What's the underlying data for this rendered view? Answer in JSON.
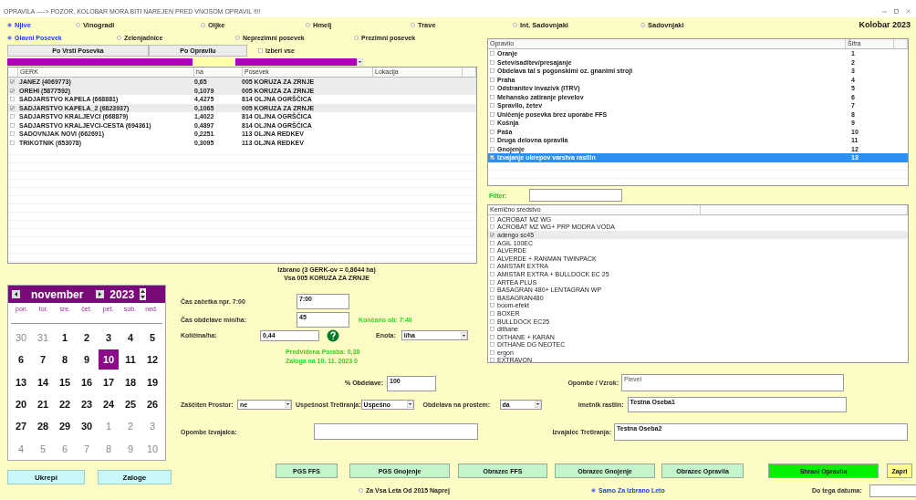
{
  "window": {
    "title": "OPRAVILA ----> POZOR, KOLOBAR MORA BITI NAREJEN PRED VNOSOM OPRAVIL !!!!"
  },
  "crop_types": [
    {
      "label": "Njive",
      "selected": true
    },
    {
      "label": "Vinogradi",
      "selected": false
    },
    {
      "label": "Oljke",
      "selected": false
    },
    {
      "label": "Hmelj",
      "selected": false
    },
    {
      "label": "Trave",
      "selected": false
    },
    {
      "label": "Int. Sadovnjaki",
      "selected": false
    },
    {
      "label": "Sadovnjaki",
      "selected": false
    }
  ],
  "year_label": "Kolobar 2023",
  "crop_groups": [
    {
      "label": "Glavni Posevek",
      "selected": true
    },
    {
      "label": "Zelenjadnice",
      "selected": false
    },
    {
      "label": "Neprezimni posevek",
      "selected": false
    },
    {
      "label": "Prezimni posevek",
      "selected": false
    }
  ],
  "sort_buttons": [
    "Po Vrsti Posevka",
    "Po Opravilu"
  ],
  "select_all": {
    "label": "Izberi vse",
    "checked": false
  },
  "fields_table": {
    "columns": [
      "GERK",
      "ha",
      "Posevek",
      "Lokacija"
    ],
    "rows": [
      {
        "checked": true,
        "cells": [
          "JANEZ (4069773)",
          "0,65",
          "005 KORUZA ZA ZRNJE"
        ]
      },
      {
        "checked": true,
        "cells": [
          "OREHI (5877592)",
          "0,1079",
          "005 KORUZA ZA ZRNJE"
        ]
      },
      {
        "checked": false,
        "cells": [
          "SADJARSTVO KAPELA (668881)",
          "4,4275",
          "814 OLJNA OGRŠČICA"
        ]
      },
      {
        "checked": true,
        "cells": [
          "SADJARSTVO KAPELA_2 (6823937)",
          "0,1065",
          "005 KORUZA ZA ZRNJE"
        ]
      },
      {
        "checked": false,
        "cells": [
          "SADJARSTVO KRALJEVCI (668879)",
          "1,4022",
          "814 OLJNA OGRŠČICA"
        ]
      },
      {
        "checked": false,
        "cells": [
          "SADJARSTVO KRALJEVCI-CESTA (694361)",
          "0,4897",
          "814 OLJNA OGRŠČICA"
        ]
      },
      {
        "checked": false,
        "cells": [
          "SADOVNJAK NOVI (662691)",
          "0,2251",
          "113 OLJNA REDKEV"
        ]
      },
      {
        "checked": false,
        "cells": [
          "TRIKOTNIK (653078)",
          "0,3095",
          "113 OLJNA REDKEV"
        ]
      }
    ]
  },
  "summary": [
    "Izbrano (3 GERK-ov = 0,8644 ha)",
    "Vsa 005 KORUZA ZA ZRNJE"
  ],
  "calendar": {
    "month": "november",
    "year": "2023",
    "weekdays": [
      "pon.",
      "tor.",
      "sre.",
      "čet.",
      "pet.",
      "sob.",
      "ned."
    ],
    "days": [
      {
        "label": "30",
        "in_month": false,
        "selected": false
      },
      {
        "label": "31",
        "in_month": false,
        "selected": false
      },
      {
        "label": "1",
        "in_month": true,
        "selected": false
      },
      {
        "label": "2",
        "in_month": true,
        "selected": false
      },
      {
        "label": "3",
        "in_month": true,
        "selected": false
      },
      {
        "label": "4",
        "in_month": true,
        "selected": false
      },
      {
        "label": "5",
        "in_month": true,
        "selected": false
      },
      {
        "label": "6",
        "in_month": true,
        "selected": false
      },
      {
        "label": "7",
        "in_month": true,
        "selected": false
      },
      {
        "label": "8",
        "in_month": true,
        "selected": false
      },
      {
        "label": "9",
        "in_month": true,
        "selected": false
      },
      {
        "label": "10",
        "in_month": true,
        "selected": true
      },
      {
        "label": "11",
        "in_month": true,
        "selected": false
      },
      {
        "label": "12",
        "in_month": true,
        "selected": false
      },
      {
        "label": "13",
        "in_month": true,
        "selected": false
      },
      {
        "label": "14",
        "in_month": true,
        "selected": false
      },
      {
        "label": "15",
        "in_month": true,
        "selected": false
      },
      {
        "label": "16",
        "in_month": true,
        "selected": false
      },
      {
        "label": "17",
        "in_month": true,
        "selected": false
      },
      {
        "label": "18",
        "in_month": true,
        "selected": false
      },
      {
        "label": "19",
        "in_month": true,
        "selected": false
      },
      {
        "label": "20",
        "in_month": true,
        "selected": false
      },
      {
        "label": "21",
        "in_month": true,
        "selected": false
      },
      {
        "label": "22",
        "in_month": true,
        "selected": false
      },
      {
        "label": "23",
        "in_month": true,
        "selected": false
      },
      {
        "label": "24",
        "in_month": true,
        "selected": false
      },
      {
        "label": "25",
        "in_month": true,
        "selected": false
      },
      {
        "label": "26",
        "in_month": true,
        "selected": false
      },
      {
        "label": "27",
        "in_month": true,
        "selected": false
      },
      {
        "label": "28",
        "in_month": true,
        "selected": false
      },
      {
        "label": "29",
        "in_month": true,
        "selected": false
      },
      {
        "label": "30",
        "in_month": true,
        "selected": false
      },
      {
        "label": "1",
        "in_month": false,
        "selected": false
      },
      {
        "label": "2",
        "in_month": false,
        "selected": false
      },
      {
        "label": "3",
        "in_month": false,
        "selected": false
      },
      {
        "label": "4",
        "in_month": false,
        "selected": false
      },
      {
        "label": "5",
        "in_month": false,
        "selected": false
      },
      {
        "label": "6",
        "in_month": false,
        "selected": false
      },
      {
        "label": "7",
        "in_month": false,
        "selected": false
      },
      {
        "label": "8",
        "in_month": false,
        "selected": false
      },
      {
        "label": "9",
        "in_month": false,
        "selected": false
      },
      {
        "label": "10",
        "in_month": false,
        "selected": false
      }
    ]
  },
  "side_buttons": [
    "Ukrepi",
    "Zaloge"
  ],
  "start_time": {
    "label": "Čas začetka npr. 7:00",
    "value": "7:00"
  },
  "duration": {
    "label": "Čas obdelave min/ha:",
    "value": "45"
  },
  "finish_note": "Končano ob: 7:40",
  "quantity": {
    "label": "Količina/ha:",
    "value": "0,44"
  },
  "unit": {
    "label": "Enota:",
    "value": "l/ha"
  },
  "forecast": [
    "Predvidena Poraba: 0,38",
    "Zaloga na 10. 11. 2023 0"
  ],
  "coverage": {
    "label": "% Obdelave:",
    "value": "100"
  },
  "protected_space": {
    "label": "Zaščiten Prostor:",
    "value": "ne"
  },
  "success": {
    "label": "Uspešnost Tretiranja:",
    "value": "Uspešno"
  },
  "outdoor": {
    "label": "Obdelava na prostem:",
    "value": "da"
  },
  "operator_notes": {
    "label": "Opombe Izvajalca:"
  },
  "notes_reason": {
    "label": "Opombe / Vzrok:",
    "value": "Plevel"
  },
  "plant_owner": {
    "label": "Imetnik rastlin:",
    "value": "Testna Oseba1"
  },
  "operator": {
    "label": "Izvajalec Tretiranja:",
    "value": "Testna Oseba2"
  },
  "tasks_list": {
    "columns": [
      "Opravilo",
      "Šifra"
    ],
    "rows": [
      {
        "name": "Oranje",
        "code": "1",
        "checked": false,
        "selected": false
      },
      {
        "name": "Setev/saditev/presajanje",
        "code": "2",
        "checked": false,
        "selected": false
      },
      {
        "name": "Obdelava tal s pogonskimi oz. gnanimi stroji",
        "code": "3",
        "checked": false,
        "selected": false
      },
      {
        "name": "Praha",
        "code": "4",
        "checked": false,
        "selected": false
      },
      {
        "name": "Odstranitev invazivk (ITRV)",
        "code": "5",
        "checked": false,
        "selected": false
      },
      {
        "name": "Mehansko zatiranje plevelov",
        "code": "6",
        "checked": false,
        "selected": false
      },
      {
        "name": "Spravilo, žetev",
        "code": "7",
        "checked": false,
        "selected": false
      },
      {
        "name": "Uničenje posevka brez uporabe FFS",
        "code": "8",
        "checked": false,
        "selected": false
      },
      {
        "name": "Košnja",
        "code": "9",
        "checked": false,
        "selected": false
      },
      {
        "name": "Paša",
        "code": "10",
        "checked": false,
        "selected": false
      },
      {
        "name": "Druga delovna opravila",
        "code": "11",
        "checked": false,
        "selected": false
      },
      {
        "name": "Gnojenje",
        "code": "12",
        "checked": false,
        "selected": false
      },
      {
        "name": "Izvajanje ukrepov varstva rastlin",
        "code": "13",
        "checked": true,
        "selected": true
      }
    ]
  },
  "filter": {
    "label": "Filter:"
  },
  "chemicals_list": {
    "columns": [
      "Kemično sredstvo"
    ],
    "rows": [
      {
        "name": "ACROBAT MZ WG",
        "checked": false,
        "selected": false
      },
      {
        "name": "ACROBAT MZ WG+ PRP MODRA VODA",
        "checked": false,
        "selected": false
      },
      {
        "name": "adengo sc45",
        "checked": true,
        "selected": true
      },
      {
        "name": "AGIL 100EC",
        "checked": false,
        "selected": false
      },
      {
        "name": "ALVERDE",
        "checked": false,
        "selected": false
      },
      {
        "name": "ALVERDE + RANMAN TWINPACK",
        "checked": false,
        "selected": false
      },
      {
        "name": "AMISTAR EXTRA",
        "checked": false,
        "selected": false
      },
      {
        "name": "AMISTAR EXTRA + BULLDOCK EC 25",
        "checked": false,
        "selected": false
      },
      {
        "name": "ARTEA PLUS",
        "checked": false,
        "selected": false
      },
      {
        "name": "BASAGRAN 480+ LENTAGRAN WP",
        "checked": false,
        "selected": false
      },
      {
        "name": "BASAGRAN480",
        "checked": false,
        "selected": false
      },
      {
        "name": "boom-efekt",
        "checked": false,
        "selected": false
      },
      {
        "name": "BOXER",
        "checked": false,
        "selected": false
      },
      {
        "name": "BULLDOCK EC25",
        "checked": false,
        "selected": false
      },
      {
        "name": "dithane",
        "checked": false,
        "selected": false
      },
      {
        "name": "DITHANE + KARAN",
        "checked": false,
        "selected": false
      },
      {
        "name": "DITHANE DG NEOTEC",
        "checked": false,
        "selected": false
      },
      {
        "name": "ergon",
        "checked": false,
        "selected": false
      },
      {
        "name": "EXTRAVON",
        "checked": false,
        "selected": false
      }
    ]
  },
  "action_buttons": [
    {
      "label": "PGS FFS",
      "kind": "form"
    },
    {
      "label": "PGS Gnojenje",
      "kind": "form"
    },
    {
      "label": "Obrazec FFS",
      "kind": "form"
    },
    {
      "label": "Obrazec Gnojenje",
      "kind": "form"
    },
    {
      "label": "Obrazec Opravila",
      "kind": "form"
    },
    {
      "label": "Shrani Opravila",
      "kind": "save"
    },
    {
      "label": "Zapri",
      "kind": "close"
    }
  ],
  "period": [
    {
      "label": "Za Vsa Leta Od 2015 Naprej",
      "selected": false
    },
    {
      "label": "Samo Za Izbrano Leto",
      "selected": true
    }
  ],
  "until_date": {
    "label": "Do tega datuma:"
  }
}
